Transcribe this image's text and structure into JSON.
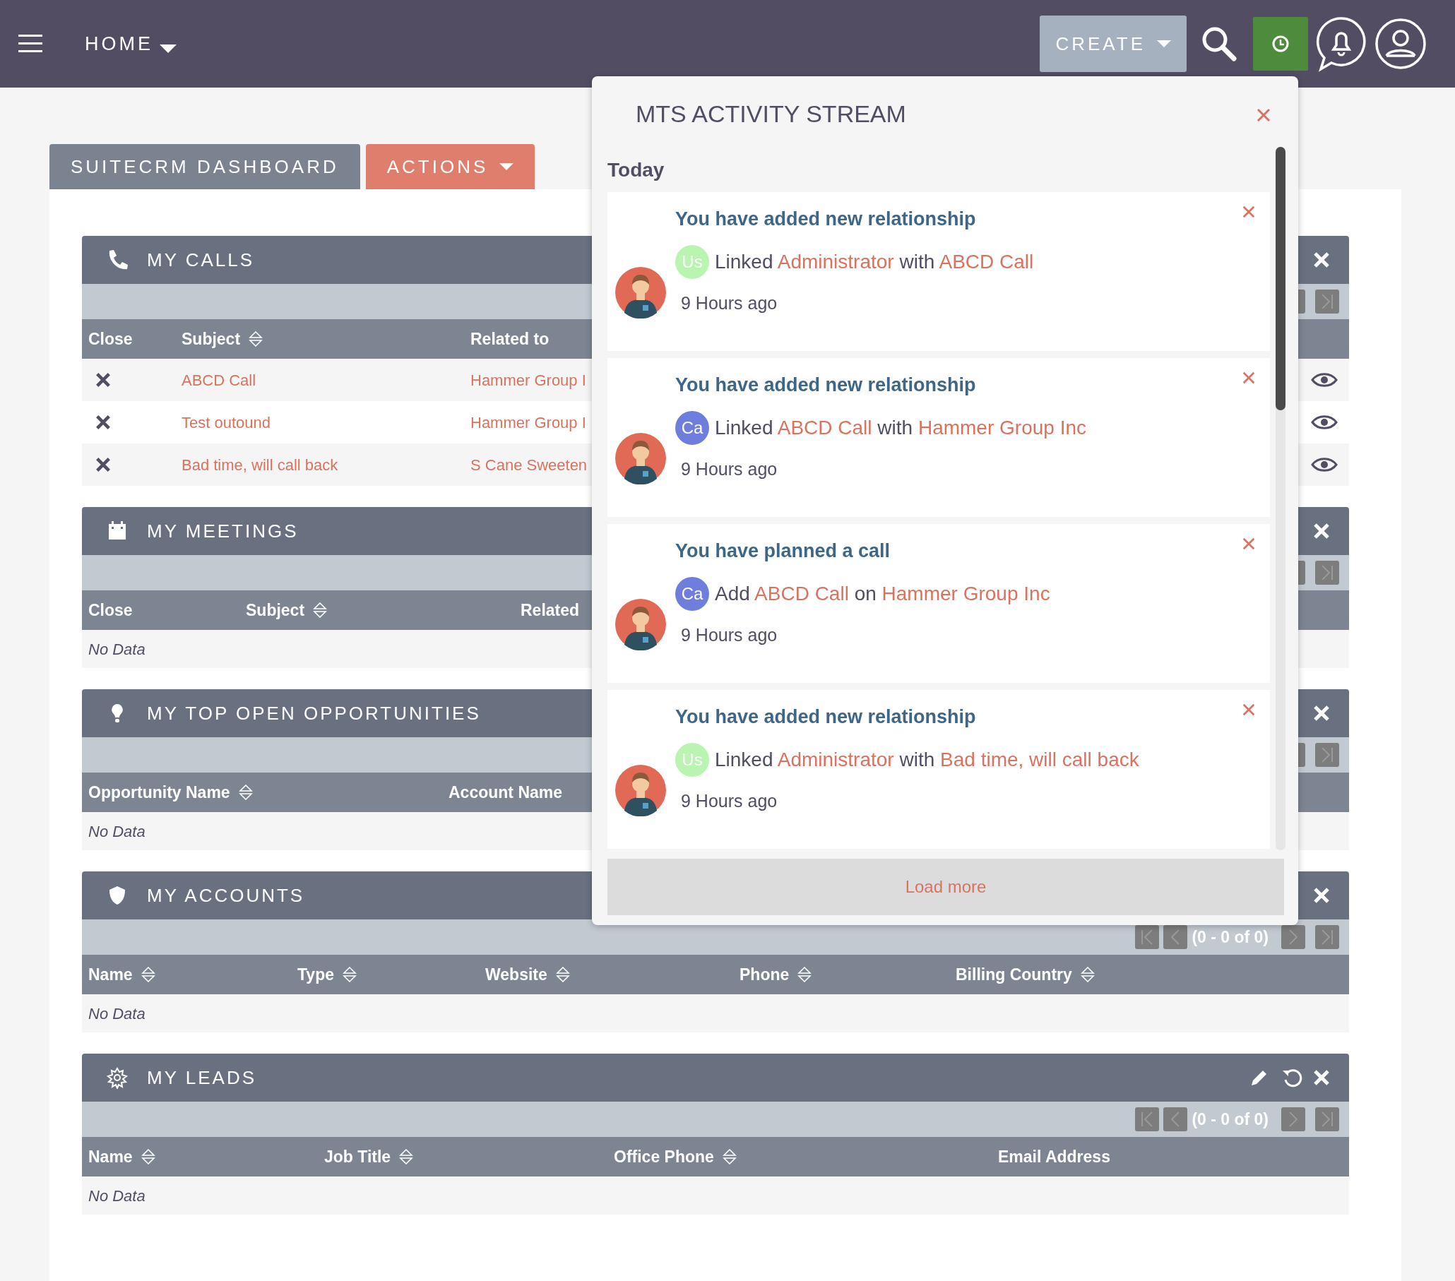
{
  "navbar": {
    "menu": "HOME",
    "create": "CREATE"
  },
  "tabs": [
    {
      "label": "SUITECRM DASHBOARD",
      "selected": true
    }
  ],
  "actions": "ACTIONS",
  "dashlets": [
    {
      "title": "MY CALLS",
      "columns": [
        {
          "label": "Close",
          "sortable": false
        },
        {
          "label": "Subject",
          "sortable": true
        },
        {
          "label": "Related to",
          "sortable": false
        }
      ],
      "rows": [
        {
          "subject": "ABCD Call",
          "related_to": "Hammer Group I"
        },
        {
          "subject": "Test outound",
          "related_to": "Hammer Group I"
        },
        {
          "subject": "Bad time, will call back",
          "related_to": "S Cane Sweeten"
        }
      ]
    },
    {
      "title": "MY MEETINGS",
      "columns": [
        {
          "label": "Close",
          "sortable": false
        },
        {
          "label": "Subject",
          "sortable": true
        },
        {
          "label": "Related",
          "sortable": false
        }
      ],
      "no_data": "No Data"
    },
    {
      "title": "MY TOP OPEN OPPORTUNITIES",
      "columns": [
        {
          "label": "Opportunity Name",
          "sortable": true
        },
        {
          "label": "Account Name",
          "sortable": false
        }
      ],
      "no_data": "No Data"
    },
    {
      "title": "MY ACCOUNTS",
      "pagination": "(0 - 0 of 0)",
      "columns": [
        {
          "label": "Name",
          "sortable": true
        },
        {
          "label": "Type",
          "sortable": true
        },
        {
          "label": "Website",
          "sortable": true
        },
        {
          "label": "Phone",
          "sortable": true
        },
        {
          "label": "Billing Country",
          "sortable": true
        }
      ],
      "no_data": "No Data"
    },
    {
      "title": "MY LEADS",
      "pagination": "(0 - 0 of 0)",
      "columns": [
        {
          "label": "Name",
          "sortable": true
        },
        {
          "label": "Job Title",
          "sortable": true
        },
        {
          "label": "Office Phone",
          "sortable": true
        },
        {
          "label": "Email Address",
          "sortable": false
        }
      ],
      "no_data": "No Data"
    }
  ],
  "activity_stream": {
    "title": "MTS ACTIVITY STREAM",
    "group": "Today",
    "load_more": "Load more",
    "items": [
      {
        "title": "You have added new relationship",
        "initials": "Us",
        "color": "#b9f5b1",
        "verb": "Linked",
        "subject": "Administrator",
        "conj": "with",
        "object": "ABCD Call",
        "time": "9 Hours ago"
      },
      {
        "title": "You have added new relationship",
        "initials": "Ca",
        "color": "#6f7edc",
        "verb": "Linked",
        "subject": "ABCD Call",
        "conj": "with",
        "object": "Hammer Group Inc",
        "time": "9 Hours ago"
      },
      {
        "title": "You have planned a call",
        "initials": "Ca",
        "color": "#6f7edc",
        "verb": "Add",
        "subject": "ABCD Call",
        "conj": "on",
        "object": "Hammer Group Inc",
        "time": "9 Hours ago"
      },
      {
        "title": "You have added new relationship",
        "initials": "Us",
        "color": "#b9f5b1",
        "verb": "Linked",
        "subject": "Administrator",
        "conj": "with",
        "object": "Bad time, will call back",
        "time": "9 Hours ago"
      }
    ]
  }
}
